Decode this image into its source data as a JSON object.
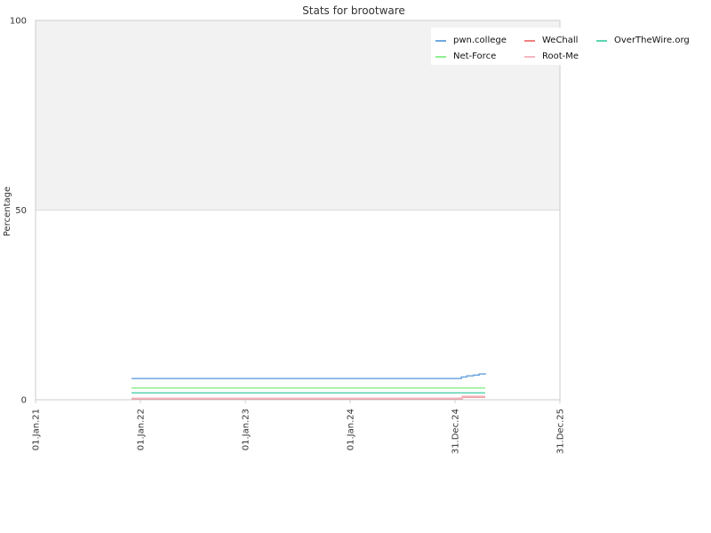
{
  "chart_data": {
    "type": "line",
    "title": "Stats for brootware",
    "ylabel": "Percentage",
    "xlabel": "",
    "ylim": [
      0,
      100
    ],
    "y_ticks": [
      0,
      50,
      100
    ],
    "y_tick_labels": [
      "0",
      "50",
      "100"
    ],
    "xlim": [
      "2021-01-01",
      "2025-12-31"
    ],
    "x_ticks": [
      "2021-01-01",
      "2022-01-01",
      "2023-01-01",
      "2024-01-01",
      "2024-12-31",
      "2025-12-31"
    ],
    "x_tick_labels": [
      "01.Jan.21",
      "01.Jan.22",
      "01.Jan.23",
      "01.Jan.24",
      "31.Dec.24",
      "31.Dec.25"
    ],
    "shaded_band": [
      50,
      100
    ],
    "legend_position": "top-right",
    "legend_columns": 3,
    "series": [
      {
        "name": "pwn.college",
        "color": "#6fa8e0",
        "points": [
          [
            "2021-12-01",
            5.6
          ],
          [
            "2025-01-15",
            5.6
          ],
          [
            "2025-01-22",
            6.0
          ],
          [
            "2025-02-10",
            6.3
          ],
          [
            "2025-03-05",
            6.5
          ],
          [
            "2025-03-25",
            6.8
          ],
          [
            "2025-04-15",
            7.0
          ]
        ]
      },
      {
        "name": "WeChall",
        "color": "#f08080",
        "points": [
          [
            "2021-12-01",
            0.3
          ],
          [
            "2025-01-15",
            0.3
          ],
          [
            "2025-01-25",
            0.7
          ],
          [
            "2025-04-15",
            0.7
          ]
        ]
      },
      {
        "name": "OverTheWire.org",
        "color": "#5ad4b0",
        "points": [
          [
            "2021-12-01",
            1.8
          ],
          [
            "2025-04-15",
            1.8
          ]
        ]
      },
      {
        "name": "Net-Force",
        "color": "#90ee90",
        "points": [
          [
            "2021-12-01",
            3.1
          ],
          [
            "2025-04-15",
            3.1
          ]
        ]
      },
      {
        "name": "Root-Me",
        "color": "#f4b6c2",
        "points": [
          [
            "2021-12-01",
            0.4
          ],
          [
            "2025-01-15",
            0.4
          ],
          [
            "2025-01-25",
            0.9
          ],
          [
            "2025-04-15",
            0.9
          ]
        ]
      }
    ]
  }
}
